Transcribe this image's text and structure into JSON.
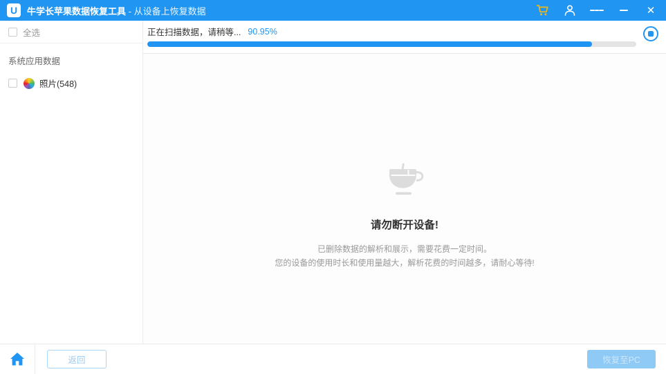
{
  "titlebar": {
    "logo_letter": "U",
    "app_title": "牛学长苹果数据恢复工具",
    "app_subtitle": " - 从设备上恢复数据",
    "close_glyph": "✕"
  },
  "sidebar": {
    "select_all_label": "全选",
    "select_all_checked": false,
    "section_title": "系统应用数据",
    "items": [
      {
        "label": "照片(548)",
        "icon": "photos-icon",
        "checked": false
      }
    ]
  },
  "progress": {
    "status_text": "正在扫描数据，请稍等...",
    "percent_label": "90.95%",
    "percent_value": 90.95
  },
  "content": {
    "icon": "coffee-cup-icon",
    "heading": "请勿断开设备!",
    "line1": "已删除数据的解析和展示，需要花费一定时间。",
    "line2": "您的设备的使用时长和使用量越大，解析花费的时间越多，请耐心等待!"
  },
  "footer": {
    "back_label": "返回",
    "recover_label": "恢复至PC"
  },
  "colors": {
    "accent_blue": "#2095f2",
    "cart_yellow": "#f0b915",
    "progress_track": "#e4e4e4",
    "disabled_button_bg": "#8fc9f5",
    "cup_gray": "#dcdcdc"
  }
}
